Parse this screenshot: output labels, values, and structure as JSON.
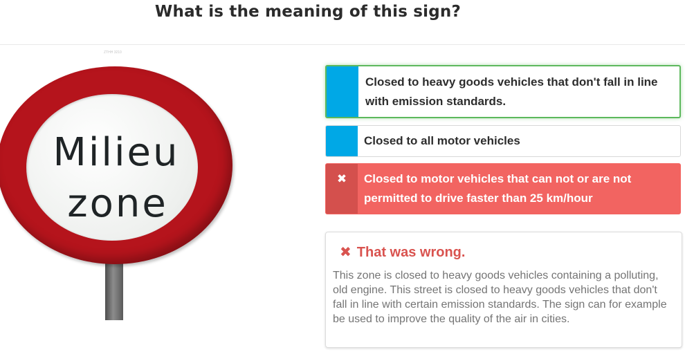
{
  "question": {
    "title": "What is the meaning of this sign?"
  },
  "image_caption": "ZTHH 3210",
  "sign": {
    "line1": "Milieu",
    "line2": "zone"
  },
  "answers": [
    {
      "label": "Closed to heavy goods vehicles that don't fall in line with emission standards.",
      "state": "correct"
    },
    {
      "label": "Closed to all motor vehicles",
      "state": "neutral"
    },
    {
      "label": "Closed to motor vehicles that can not or are not permitted to drive faster than 25 km/hour",
      "state": "selected-wrong",
      "icon": "✖"
    }
  ],
  "feedback": {
    "icon": "✖",
    "heading": "That was wrong.",
    "text": "This zone is closed to heavy goods vehicles containing a polluting, old engine. This street is closed to heavy goods vehicles that don't fall in line with certain emission standards. The sign can for example be used to improve the quality of the air in cities."
  },
  "colors": {
    "correct_border": "#5cb85c",
    "marker_blue": "#00a8e6",
    "wrong_bg": "#f26461",
    "wrong_text": "#d9534f",
    "sign_red": "#b5141c"
  }
}
